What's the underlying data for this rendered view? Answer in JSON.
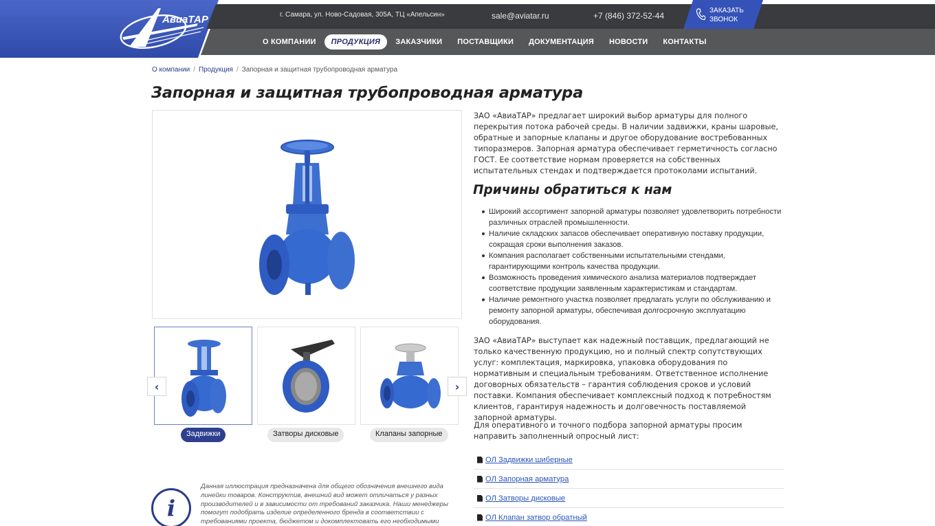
{
  "header": {
    "logo_text": "АвиаТАР",
    "address": "г. Самара, ул. Ново-Садовая, 305А, ТЦ «Апельсин»",
    "email": "sale@aviatar.ru",
    "phone": "+7 (846) 372-52-44",
    "callback_line1": "ЗАКАЗАТЬ",
    "callback_line2": "ЗВОНОК",
    "nav": [
      {
        "label": "О КОМПАНИИ",
        "active": false
      },
      {
        "label": "ПРОДУКЦИЯ",
        "active": true
      },
      {
        "label": "ЗАКАЗЧИКИ",
        "active": false
      },
      {
        "label": "ПОСТАВЩИКИ",
        "active": false
      },
      {
        "label": "ДОКУМЕНТАЦИЯ",
        "active": false
      },
      {
        "label": "НОВОСТИ",
        "active": false
      },
      {
        "label": "КОНТАКТЫ",
        "active": false
      }
    ],
    "colors": {
      "brand_blue": "#3552b8",
      "topbar": "#3a3b3f",
      "navbar": "#555759"
    }
  },
  "breadcrumb": {
    "home": "О компании",
    "section": "Продукция",
    "current": "Запорная и защитная трубопроводная арматура",
    "separator": "/"
  },
  "page_title": "Запорная и защитная трубопроводная арматура",
  "gallery": {
    "prev_icon": "chevron-left-icon",
    "next_icon": "chevron-right-icon",
    "thumbs": [
      {
        "label": "Задвижки",
        "active": true
      },
      {
        "label": "Затворы дисковые",
        "active": false
      },
      {
        "label": "Клапаны запорные",
        "active": false
      }
    ]
  },
  "info_note": "Данная иллюстрация предназначена для общего обозначения внешнего вида линейки товаров. Конструктив, внешний вид может отличаться у разных производителей и в зависимости от требований заказчика. Наши менеджеры помогут подобрать изделие определенного бренда в соответствии с требованиями проекта, бюджетом и докомплектовать его необходимыми",
  "intro": "ЗАО «АвиаТАР» предлагает широкий выбор арматуры для полного перекрытия потока рабочей среды. В наличии задвижки, краны шаровые, обратные и запорные клапаны и другое оборудование востребованных типоразмеров. Запорная арматура обеспечивает герметичность согласно ГОСТ. Ее соответствие нормам проверяется на собственных испытательных стендах и подтверждается протоколами испытаний.",
  "reasons_title": "Причины обратиться к нам",
  "reasons": [
    "Широкий ассортимент запорной арматуры позволяет удовлетворить потребности различных отраслей промышленности.",
    "Наличие складских запасов обеспечивает оперативную поставку продукции, сокращая сроки выполнения заказов.",
    "Компания располагает собственными испытательными стендами, гарантирующими контроль качества продукции.",
    "Возможность проведения химического анализа материалов подтверждает соответствие продукции заявленным характеристикам и стандартам.",
    "Наличие ремонтного участка позволяет предлагать услуги по обслуживанию и ремонту запорной арматуры, обеспечивая долгосрочную эксплуатацию оборудования."
  ],
  "supplier_text": "ЗАО «АвиаТАР» выступает как надежный поставщик, предлагающий не только качественную продукцию, но и полный спектр сопутствующих услуг: комплектация, маркировка, упаковка оборудования по нормативным и специальным требованиям. Ответственное исполнение договорных обязательств – гарантия соблюдения сроков и условий поставки. Компания обеспечивает комплексный подход к потребностям клиентов, гарантируя надежность и долговечность поставляемой запорной арматуры.",
  "request_text": "Для оперативного и точного подбора запорной арматуры просим направить заполненный опросный лист:",
  "docs": [
    "ОЛ Задвижки шиберные",
    "ОЛ Запорная арматура",
    "ОЛ Затворы дисковые",
    "ОЛ Клапан затвор обратный"
  ]
}
